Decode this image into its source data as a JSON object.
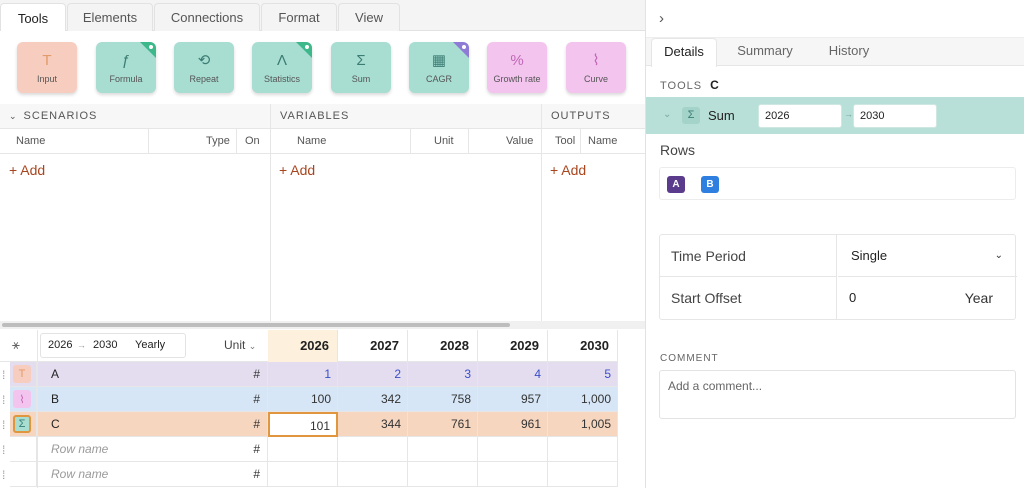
{
  "tabs": [
    "Tools",
    "Elements",
    "Connections",
    "Format",
    "View"
  ],
  "tools": [
    {
      "label": "Input",
      "icon": "T",
      "bg": "#f7cdbf",
      "fg": "#e39a6a",
      "badge": ""
    },
    {
      "label": "Formula",
      "icon": "ƒ",
      "bg": "#a8ddd2",
      "fg": "#3b7d73",
      "badge": "#3cb88a"
    },
    {
      "label": "Repeat",
      "icon": "⟲",
      "bg": "#a8ddd2",
      "fg": "#3b7d73",
      "badge": ""
    },
    {
      "label": "Statistics",
      "icon": "Λ",
      "bg": "#a8ddd2",
      "fg": "#3b7d73",
      "badge": "#3cb88a"
    },
    {
      "label": "Sum",
      "icon": "Σ",
      "bg": "#a8ddd2",
      "fg": "#3b7d73",
      "badge": ""
    },
    {
      "label": "CAGR",
      "icon": "▦",
      "bg": "#a8ddd2",
      "fg": "#3b7d73",
      "badge": "#8e7bd6"
    },
    {
      "label": "Growth rate",
      "icon": "%",
      "bg": "#f3c4ee",
      "fg": "#c267b8",
      "badge": ""
    },
    {
      "label": "Curve",
      "icon": "⌇",
      "bg": "#f3c4ee",
      "fg": "#c267b8",
      "badge": ""
    }
  ],
  "scenarios": {
    "title": "SCENARIOS",
    "cols": [
      "Name",
      "Type",
      "On"
    ],
    "add": "+ Add"
  },
  "variables": {
    "title": "VARIABLES",
    "cols": [
      "Name",
      "Unit",
      "Value"
    ],
    "add": "+ Add"
  },
  "outputs": {
    "title": "OUTPUTS",
    "cols": [
      "Tool",
      "Name"
    ],
    "add": "+ Add"
  },
  "grid": {
    "range_start": "2026",
    "range_end": "2030",
    "period": "Yearly",
    "unit_label": "Unit",
    "years": [
      "2026",
      "2027",
      "2028",
      "2029",
      "2030"
    ],
    "rows": [
      {
        "name": "A",
        "unit": "#",
        "values": [
          "1",
          "2",
          "3",
          "4",
          "5"
        ]
      },
      {
        "name": "B",
        "unit": "#",
        "values": [
          "100",
          "342",
          "758",
          "957",
          "1,000"
        ]
      },
      {
        "name": "C",
        "unit": "#",
        "values": [
          "101",
          "344",
          "761",
          "961",
          "1,005"
        ]
      },
      {
        "name": "",
        "placeholder": "Row name",
        "unit": "#",
        "values": [
          "",
          "",
          "",
          "",
          ""
        ]
      },
      {
        "name": "",
        "placeholder": "Row name",
        "unit": "#",
        "values": [
          "",
          "",
          "",
          "",
          ""
        ]
      }
    ]
  },
  "panel": {
    "tabs": [
      "Details",
      "Summary",
      "History"
    ],
    "tools_label": "TOOLS",
    "tools_target": "C",
    "sum_label": "Sum",
    "sum_start": "2026",
    "sum_end": "2030",
    "rows_label": "Rows",
    "chips": [
      "A",
      "B"
    ],
    "time_period_label": "Time Period",
    "time_period_value": "Single",
    "start_offset_label": "Start Offset",
    "start_offset_value": "0",
    "start_offset_unit": "Year",
    "comment_label": "COMMENT",
    "comment_placeholder": "Add a comment..."
  },
  "colors": {
    "input_row": "#e4ddf0",
    "growth_row": "#d6e6f7",
    "sum_row": "#f7d6c0",
    "highlight_col": "#fdf1dd",
    "accent_add": "#a9461f",
    "sum_bar": "#b8e0d8",
    "chip_a": "#5b3b8c",
    "chip_b": "#2f7fe0"
  }
}
